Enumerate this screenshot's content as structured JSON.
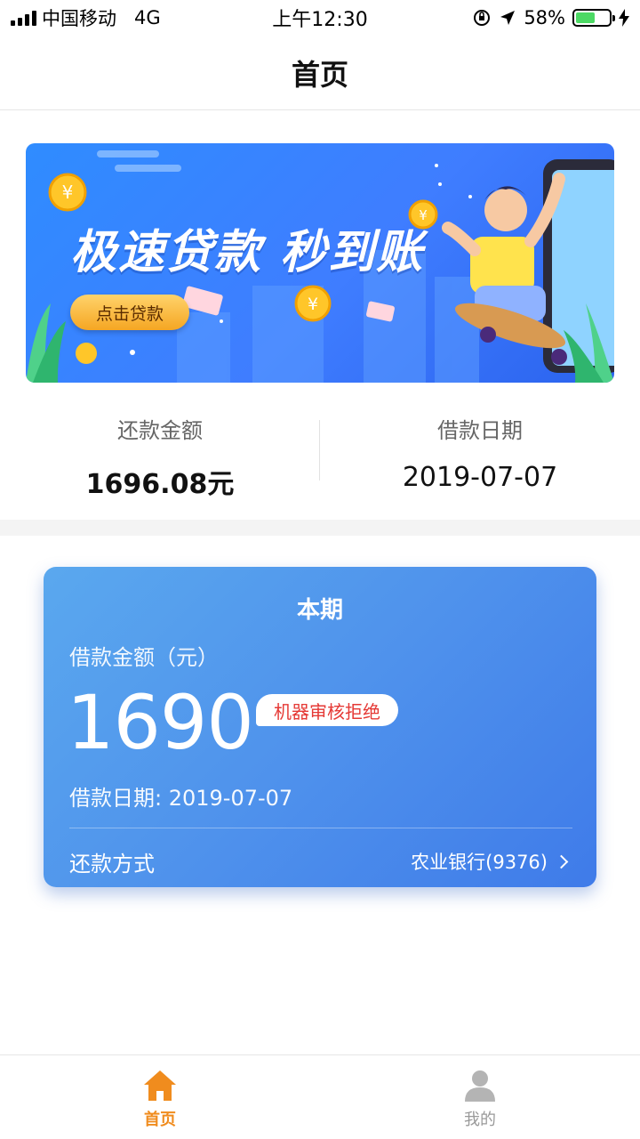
{
  "status_bar": {
    "carrier": "中国移动",
    "network": "4G",
    "time": "上午12:30",
    "battery_percent": "58%",
    "battery_level": 0.58
  },
  "nav": {
    "title": "首页"
  },
  "banner": {
    "headline": "极速贷款 秒到账",
    "button_label": "点击贷款"
  },
  "summary": {
    "repay_amount_label": "还款金额",
    "repay_amount_value": "1696.08元",
    "loan_date_label": "借款日期",
    "loan_date_value": "2019-07-07"
  },
  "card": {
    "title": "本期",
    "amount_label": "借款金额（元）",
    "amount": "1690",
    "status_badge": "机器审核拒绝",
    "date_text": "借款日期: 2019-07-07",
    "repay_method_label": "还款方式",
    "repay_method_value": "农业银行(9376)"
  },
  "tabs": [
    {
      "label": "首页",
      "icon": "home-icon",
      "active": true
    },
    {
      "label": "我的",
      "icon": "user-icon",
      "active": false
    }
  ],
  "colors": {
    "accent": "#f08c1e",
    "card_blue": "#4f92ec",
    "badge_red": "#e53935"
  }
}
